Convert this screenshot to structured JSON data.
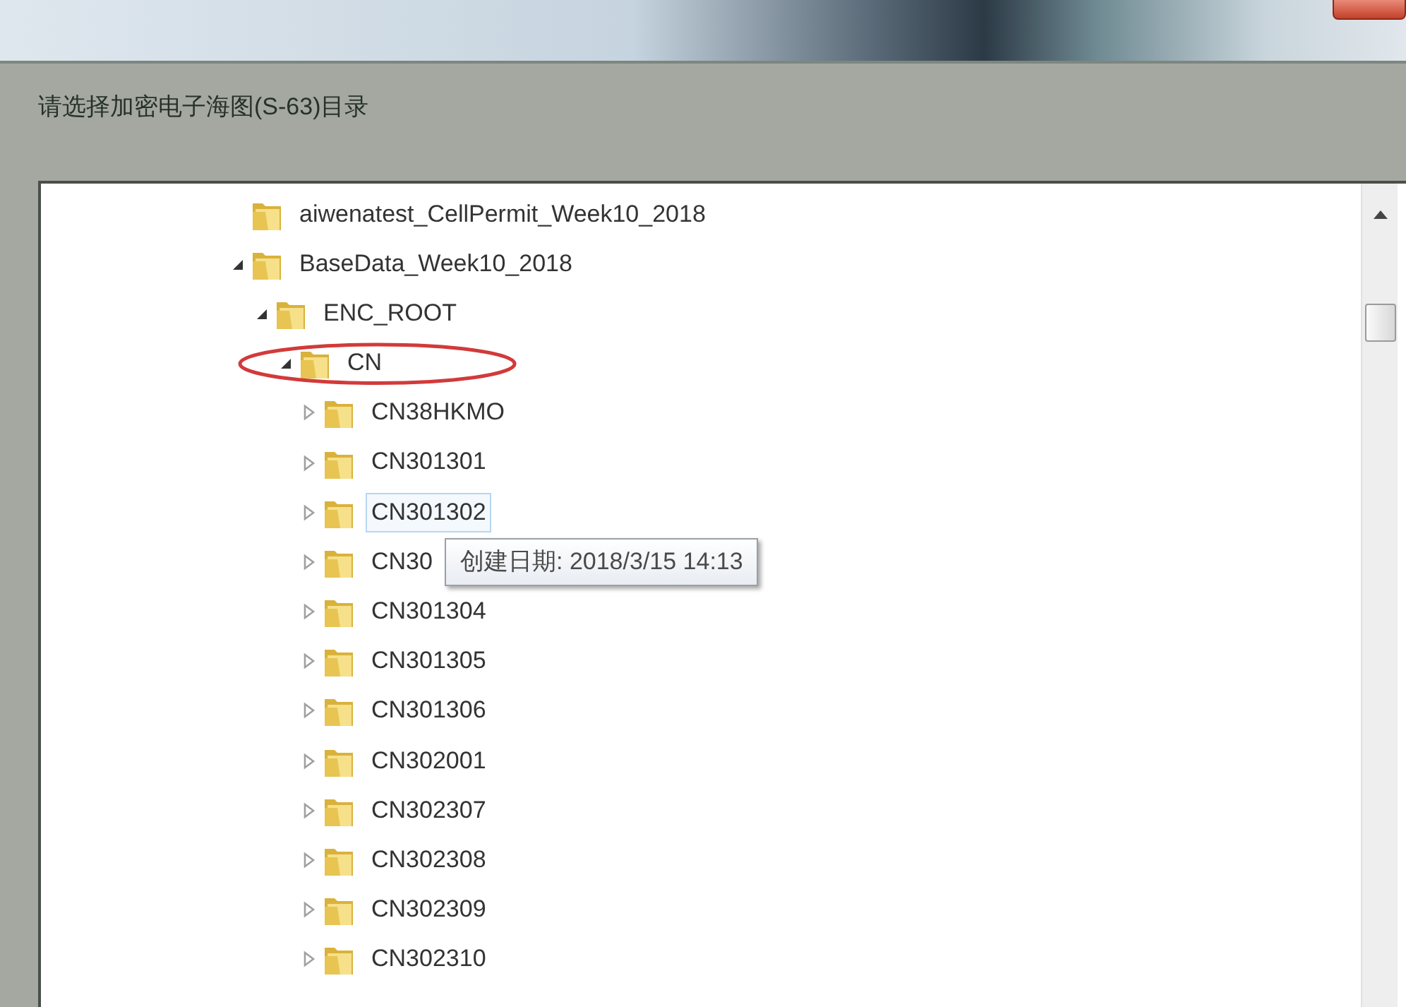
{
  "window": {
    "close_button": true
  },
  "prompt": "请选择加密电子海图(S-63)目录",
  "tree": [
    {
      "label": "aiwenatest_CellPermit_Week10_2018",
      "kind": "plain",
      "hovered": false,
      "circled": false
    },
    {
      "label": "BaseData_Week10_2018",
      "kind": "expandable",
      "expanded": true,
      "hovered": false,
      "circled": false,
      "children": [
        {
          "label": "ENC_ROOT",
          "kind": "expandable",
          "expanded": true,
          "hovered": false,
          "circled": false,
          "children": [
            {
              "label": "CN",
              "kind": "expandable",
              "expanded": true,
              "hovered": false,
              "circled": true,
              "children": [
                {
                  "label": "CN38HKMO",
                  "kind": "expandable",
                  "expanded": false,
                  "hovered": false,
                  "circled": false
                },
                {
                  "label": "CN301301",
                  "kind": "expandable",
                  "expanded": false,
                  "hovered": false,
                  "circled": false
                },
                {
                  "label": "CN301302",
                  "kind": "expandable",
                  "expanded": false,
                  "hovered": true,
                  "circled": false
                },
                {
                  "label": "CN30",
                  "kind": "expandable",
                  "expanded": false,
                  "hovered": false,
                  "circled": false
                },
                {
                  "label": "CN301304",
                  "kind": "expandable",
                  "expanded": false,
                  "hovered": false,
                  "circled": false
                },
                {
                  "label": "CN301305",
                  "kind": "expandable",
                  "expanded": false,
                  "hovered": false,
                  "circled": false
                },
                {
                  "label": "CN301306",
                  "kind": "expandable",
                  "expanded": false,
                  "hovered": false,
                  "circled": false
                },
                {
                  "label": "CN302001",
                  "kind": "expandable",
                  "expanded": false,
                  "hovered": false,
                  "circled": false
                },
                {
                  "label": "CN302307",
                  "kind": "expandable",
                  "expanded": false,
                  "hovered": false,
                  "circled": false
                },
                {
                  "label": "CN302308",
                  "kind": "expandable",
                  "expanded": false,
                  "hovered": false,
                  "circled": false
                },
                {
                  "label": "CN302309",
                  "kind": "expandable",
                  "expanded": false,
                  "hovered": false,
                  "circled": false
                },
                {
                  "label": "CN302310",
                  "kind": "expandable",
                  "expanded": false,
                  "hovered": false,
                  "circled": false
                }
              ]
            }
          ]
        }
      ]
    }
  ],
  "tooltip": "创建日期: 2018/3/15 14:13"
}
